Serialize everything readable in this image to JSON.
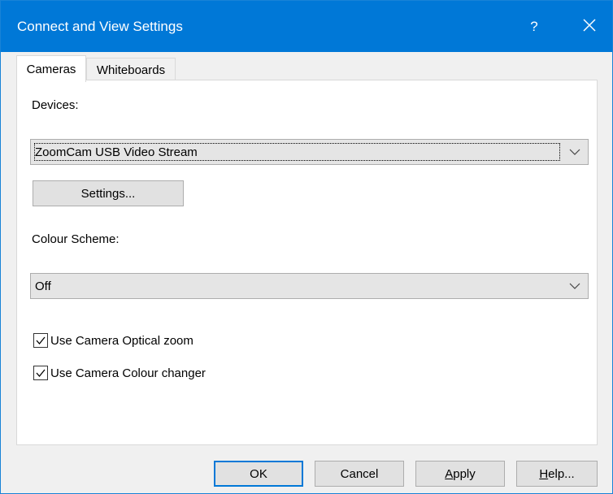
{
  "window": {
    "title": "Connect and View Settings",
    "help_glyph": "?",
    "close_icon": "close-icon"
  },
  "tabs": [
    {
      "label": "Cameras",
      "active": true
    },
    {
      "label": "Whiteboards",
      "active": false
    }
  ],
  "cameras": {
    "devices_label": "Devices:",
    "device_selected": "ZoomCam USB Video Stream",
    "settings_button": "Settings...",
    "colour_scheme_label": "Colour Scheme:",
    "colour_scheme_selected": "Off",
    "checkboxes": [
      {
        "label": "Use Camera Optical zoom",
        "checked": true
      },
      {
        "label": "Use Camera Colour changer",
        "checked": true
      }
    ]
  },
  "buttons": {
    "ok": "OK",
    "cancel": "Cancel",
    "apply_first": "A",
    "apply_rest": "pply",
    "help_first": "H",
    "help_rest": "elp..."
  },
  "colors": {
    "titlebar": "#0078d7",
    "dialog_bg": "#f0f0f0",
    "default_button_border": "#0078d7"
  }
}
